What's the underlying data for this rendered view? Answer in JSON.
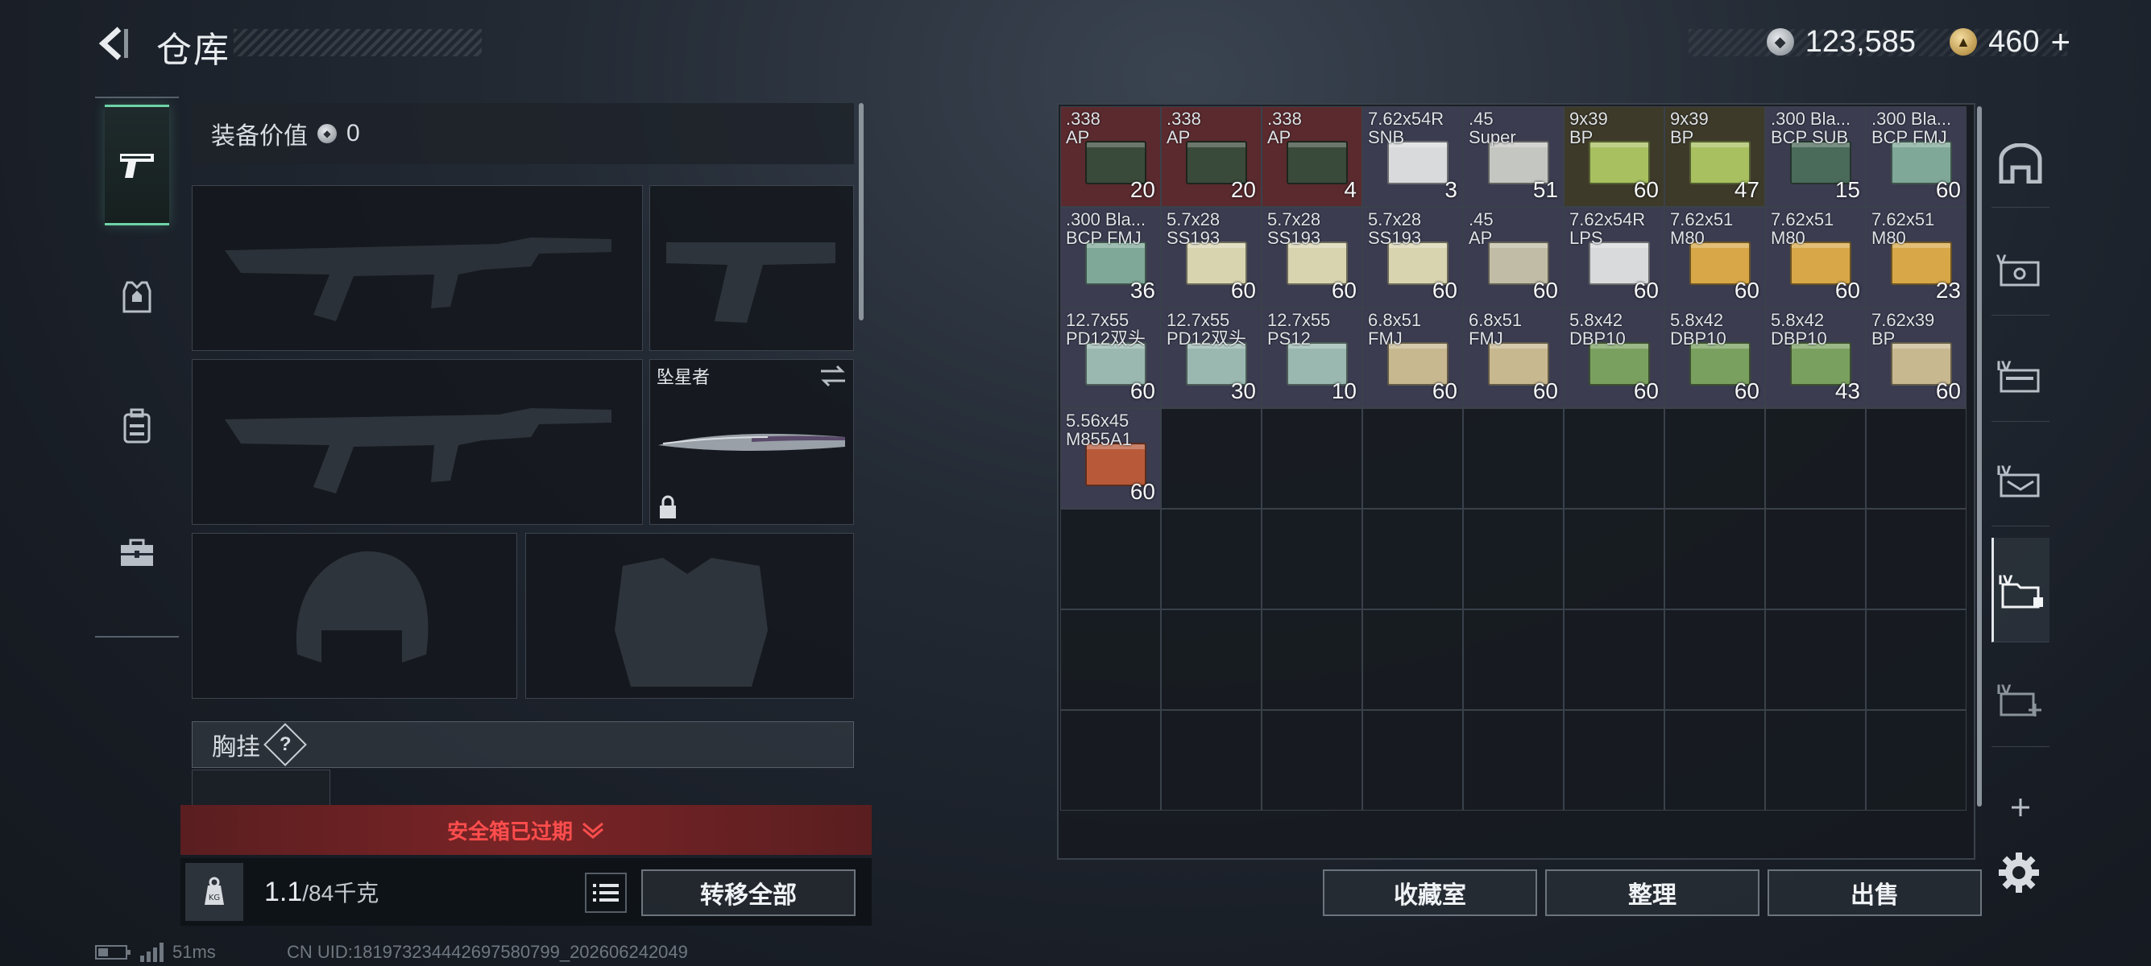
{
  "header": {
    "title": "仓库"
  },
  "currency": {
    "silver": "123,585",
    "gold": "460",
    "add": "+"
  },
  "loadout": {
    "equip_value_label": "装备价值",
    "equip_value": "0",
    "melee_name": "坠星者",
    "chest_rig_label": "胸挂",
    "chest_rig_help": "?",
    "safebox_status": "安全箱已过期",
    "weight_current": "1.1",
    "weight_max": "/84千克",
    "transfer_all": "转移全部"
  },
  "stash": {
    "items": [
      {
        "name": ".338\nAP",
        "qty": "20",
        "color": "#3a4a3a",
        "bg": "#5a2a2e"
      },
      {
        "name": ".338\nAP",
        "qty": "20",
        "color": "#3a4a3a",
        "bg": "#5a2a2e"
      },
      {
        "name": ".338\nAP",
        "qty": "4",
        "color": "#3a4a3a",
        "bg": "#5a2a2e"
      },
      {
        "name": "7.62x54R\nSNB",
        "qty": "3",
        "color": "#d8dadc",
        "bg": "#3b3c50"
      },
      {
        "name": ".45\nSuper",
        "qty": "51",
        "color": "#c4c6c2",
        "bg": "#3b3c50"
      },
      {
        "name": "9x39\nBP",
        "qty": "60",
        "color": "#a8c060",
        "bg": "#3e3a2a"
      },
      {
        "name": "9x39\nBP",
        "qty": "47",
        "color": "#a8c060",
        "bg": "#3e3a2a"
      },
      {
        "name": ".300 Bla...\nBCP SUB",
        "qty": "15",
        "color": "#4a6a5a",
        "bg": "#3b3c50"
      },
      {
        "name": ".300 Bla...\nBCP FMJ",
        "qty": "60",
        "color": "#7fa898",
        "bg": "#3b3c50"
      },
      {
        "name": ".300 Bla...\nBCP FMJ",
        "qty": "36",
        "color": "#7fa898",
        "bg": "#3b3c50"
      },
      {
        "name": "5.7x28\nSS193",
        "qty": "60",
        "color": "#d8d4b0",
        "bg": "#3b3c50"
      },
      {
        "name": "5.7x28\nSS193",
        "qty": "60",
        "color": "#d8d4b0",
        "bg": "#3b3c50"
      },
      {
        "name": "5.7x28\nSS193",
        "qty": "60",
        "color": "#d8d4b0",
        "bg": "#3b3c50"
      },
      {
        "name": ".45\nAP",
        "qty": "60",
        "color": "#c0bca6",
        "bg": "#3b3c50"
      },
      {
        "name": "7.62x54R\nLPS",
        "qty": "60",
        "color": "#d8dadc",
        "bg": "#3b3c50"
      },
      {
        "name": "7.62x51\nM80",
        "qty": "60",
        "color": "#d8a848",
        "bg": "#3b3c50"
      },
      {
        "name": "7.62x51\nM80",
        "qty": "60",
        "color": "#d8a848",
        "bg": "#3b3c50"
      },
      {
        "name": "7.62x51\nM80",
        "qty": "23",
        "color": "#d8a848",
        "bg": "#3b3c50"
      },
      {
        "name": "12.7x55\nPD12双头",
        "qty": "60",
        "color": "#9ab8b0",
        "bg": "#3b3c50"
      },
      {
        "name": "12.7x55\nPD12双头",
        "qty": "30",
        "color": "#9ab8b0",
        "bg": "#3b3c50"
      },
      {
        "name": "12.7x55\nPS12",
        "qty": "10",
        "color": "#9ab8b0",
        "bg": "#3b3c50"
      },
      {
        "name": "6.8x51\nFMJ",
        "qty": "60",
        "color": "#c8b890",
        "bg": "#3b3c50"
      },
      {
        "name": "6.8x51\nFMJ",
        "qty": "60",
        "color": "#c8b890",
        "bg": "#3b3c50"
      },
      {
        "name": "5.8x42\nDBP10",
        "qty": "60",
        "color": "#7aa060",
        "bg": "#3b3c50"
      },
      {
        "name": "5.8x42\nDBP10",
        "qty": "60",
        "color": "#7aa060",
        "bg": "#3b3c50"
      },
      {
        "name": "5.8x42\nDBP10",
        "qty": "43",
        "color": "#7aa060",
        "bg": "#3b3c50"
      },
      {
        "name": "7.62x39\nBP",
        "qty": "60",
        "color": "#c8b890",
        "bg": "#3b3c50"
      },
      {
        "name": "5.56x45\nM855A1",
        "qty": "60",
        "color": "#b85a3a",
        "bg": "#3b3c50"
      }
    ],
    "total_cells": 63
  },
  "bottom_buttons": {
    "collection": "收藏室",
    "sort": "整理",
    "sell": "出售"
  },
  "status": {
    "ping": "51ms",
    "uid": "CN UID:18197323444269758079​9_202606242049"
  }
}
